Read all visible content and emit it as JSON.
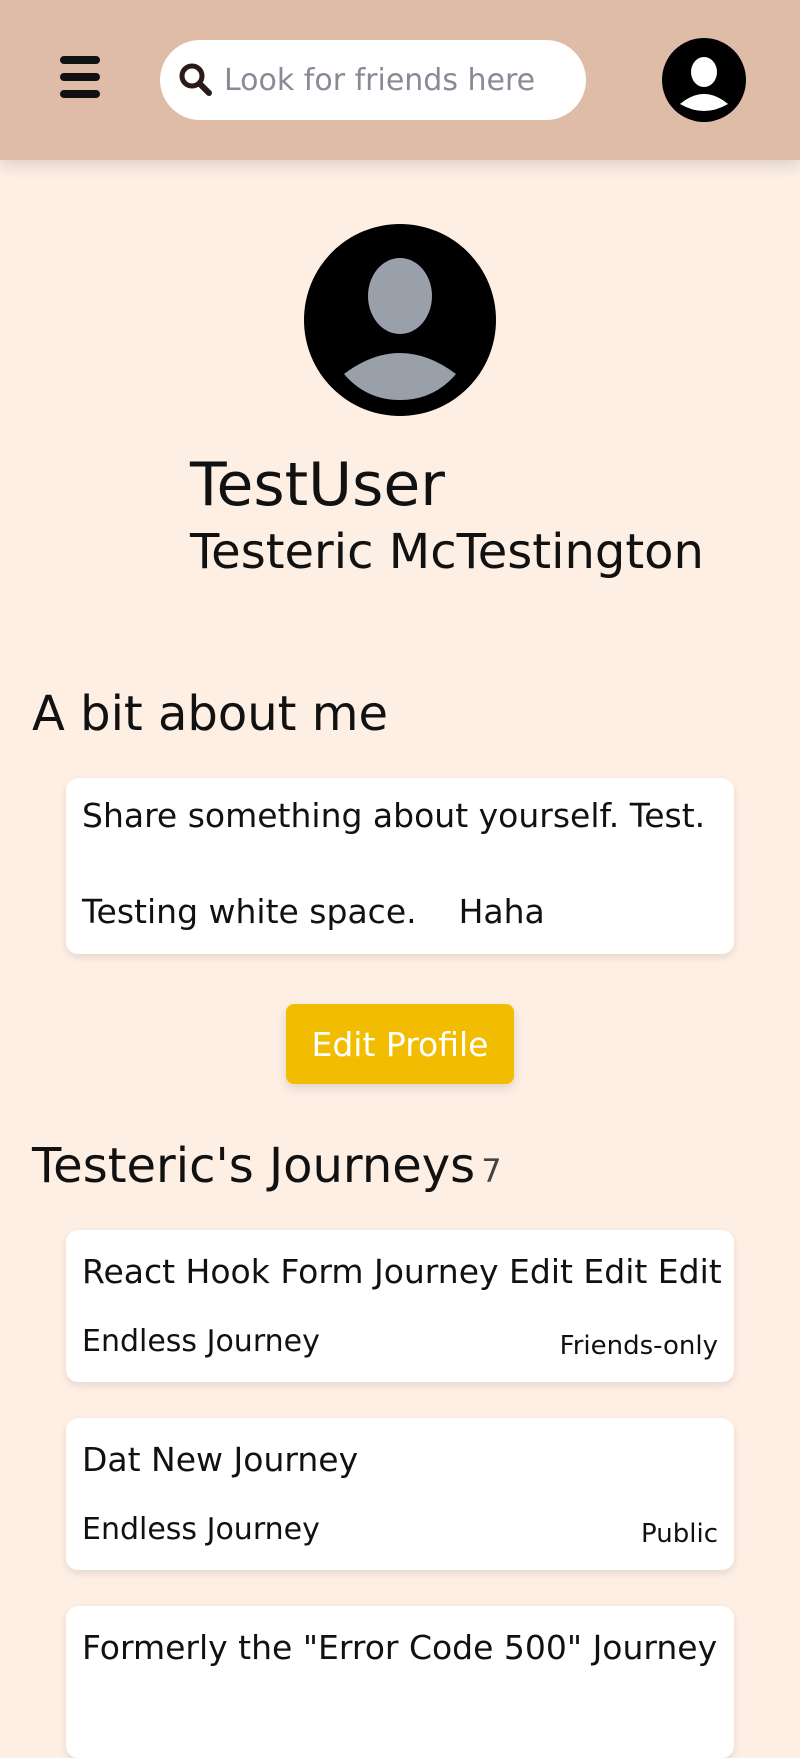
{
  "header": {
    "search_placeholder": "Look for friends here"
  },
  "profile": {
    "username": "TestUser",
    "full_name": "Testeric McTestington"
  },
  "about": {
    "heading": "A bit about me",
    "lines": [
      "Share something about yourself. Test.",
      "Testing white space.    Haha"
    ]
  },
  "edit_button_label": "Edit Profile",
  "journeys": {
    "heading": "Testeric's Journeys",
    "count": "7",
    "items": [
      {
        "title": "React Hook Form Journey Edit Edit Edit",
        "type": "Endless Journey",
        "visibility": "Friends-only"
      },
      {
        "title": "Dat New Journey",
        "type": "Endless Journey",
        "visibility": "Public"
      },
      {
        "title": "Formerly the \"Error Code 500\" Journey",
        "type": "",
        "visibility": ""
      }
    ]
  },
  "icons": {
    "menu": "hamburger-menu-icon",
    "search": "search-icon",
    "account": "user-avatar-icon"
  },
  "colors": {
    "header_bg": "#dfbca8",
    "page_bg": "#fdefe4",
    "button_bg": "#f2bd00",
    "avatar_silhouette": "#9aa0aa"
  }
}
